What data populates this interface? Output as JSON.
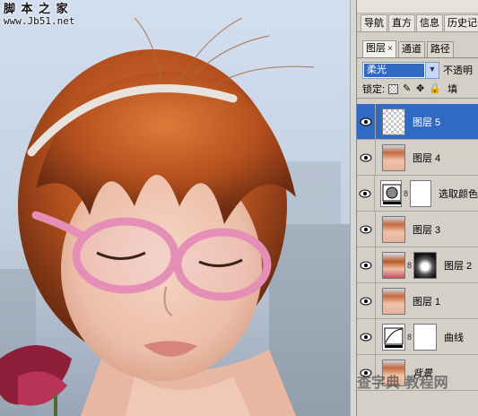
{
  "watermark": {
    "title": "脚 本 之 家",
    "url": "www.Jb51.net"
  },
  "header_tabs": [
    "导航",
    "直方",
    "信息",
    "历史记录"
  ],
  "layer_tabs": [
    {
      "label": "图层",
      "close": "×",
      "active": true
    },
    {
      "label": "通道",
      "active": false
    },
    {
      "label": "路径",
      "active": false
    }
  ],
  "blend_mode": "柔光",
  "opacity_label": "不透明",
  "lock_label": "锁定:",
  "fill_label": "填",
  "layers": [
    {
      "name": "图层 5",
      "selected": true,
      "thumb": "transparent",
      "mask": false
    },
    {
      "name": "图层 4",
      "selected": false,
      "thumb": "photo",
      "mask": false
    },
    {
      "name": "选取颜色",
      "selected": false,
      "thumb": "adjustment-selective-color",
      "mask": true
    },
    {
      "name": "图层 3",
      "selected": false,
      "thumb": "photo",
      "mask": false
    },
    {
      "name": "图层 2",
      "selected": false,
      "thumb": "photo",
      "mask": true
    },
    {
      "name": "图层 1",
      "selected": false,
      "thumb": "photo",
      "mask": false
    },
    {
      "name": "曲线",
      "selected": false,
      "thumb": "adjustment-curves",
      "mask": true
    },
    {
      "name": "背景",
      "selected": false,
      "thumb": "photo",
      "mask": false
    }
  ],
  "bottom_watermark": "查字典 教程网",
  "colors": {
    "selected_row": "#316ac5",
    "panel_bg": "#d4d0c8",
    "hair": "#b9531f",
    "glasses": "#e58fb6"
  }
}
